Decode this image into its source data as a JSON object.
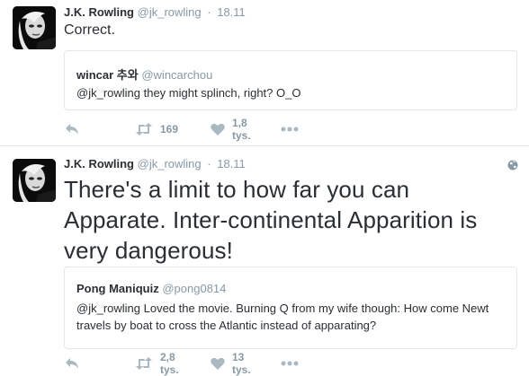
{
  "tweets": [
    {
      "author_name": "J.K. Rowling",
      "author_handle": "@jk_rowling",
      "separator": "·",
      "date": "18.11",
      "text": "Correct.",
      "quoted": {
        "author_name": "wincar 추와",
        "author_handle": "@wincarchou",
        "text": "@jk_rowling they might splinch, right? O_O"
      },
      "retweet_count": "169",
      "like_count": "1,8 tys."
    },
    {
      "author_name": "J.K. Rowling",
      "author_handle": "@jk_rowling",
      "separator": "·",
      "date": "18.11",
      "text": "There's a limit to how far you can Apparate. Inter-continental Apparition is very dangerous!",
      "quoted": {
        "author_name": "Pong Maniquiz",
        "author_handle": "@pong0814",
        "text": "@jk_rowling Loved the movie. Burning Q from my wife though: How come Newt travels by boat to cross the Atlantic instead of apparating?"
      },
      "retweet_count": "2,8 tys.",
      "like_count": "13 tys."
    }
  ],
  "icons": {
    "reply": "reply-icon",
    "retweet": "retweet-icon",
    "like": "heart-icon",
    "more": "more-icon",
    "globe": "globe-icon"
  },
  "colors": {
    "icon_gray": "#aab8c2",
    "text_gray": "#8899a6",
    "text_dark": "#292f33",
    "border": "#e1e8ed"
  }
}
